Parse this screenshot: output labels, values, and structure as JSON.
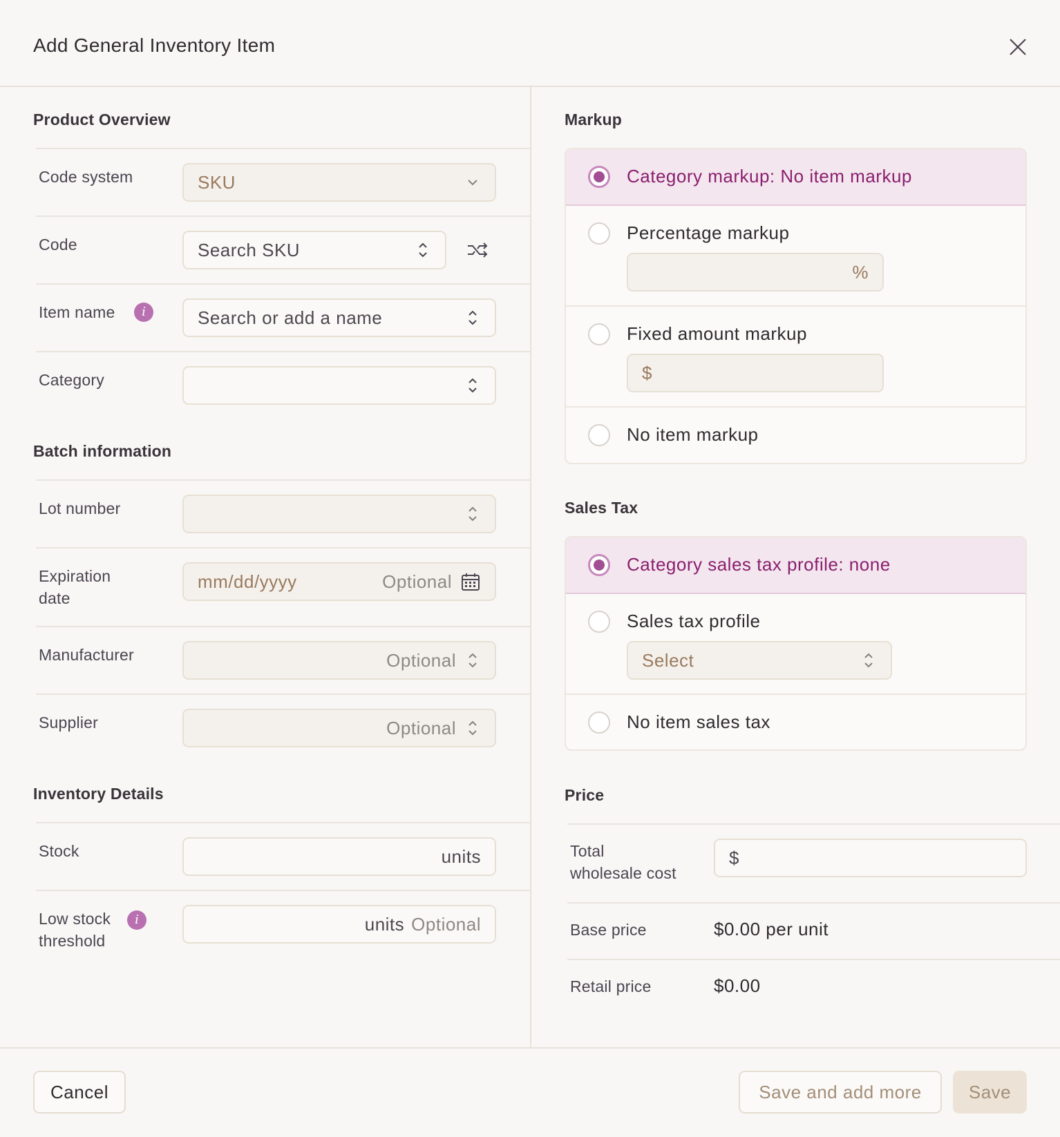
{
  "dialog": {
    "title": "Add General Inventory Item"
  },
  "product_overview": {
    "title": "Product Overview",
    "code_system": {
      "label": "Code system",
      "value": "SKU"
    },
    "code": {
      "label": "Code",
      "placeholder": "Search SKU"
    },
    "item_name": {
      "label": "Item name",
      "placeholder": "Search or add a name"
    },
    "category": {
      "label": "Category",
      "value": ""
    }
  },
  "batch_information": {
    "title": "Batch information",
    "lot_number": {
      "label": "Lot number",
      "value": ""
    },
    "expiration_date": {
      "label_line1": "Expiration",
      "label_line2": "date",
      "placeholder": "mm/dd/yyyy",
      "hint": "Optional"
    },
    "manufacturer": {
      "label": "Manufacturer",
      "hint": "Optional"
    },
    "supplier": {
      "label": "Supplier",
      "hint": "Optional"
    }
  },
  "inventory_details": {
    "title": "Inventory Details",
    "stock": {
      "label": "Stock",
      "unit": "units"
    },
    "low_stock": {
      "label_line1": "Low stock",
      "label_line2": "threshold",
      "unit": "units",
      "hint": "Optional"
    }
  },
  "markup": {
    "title": "Markup",
    "options": {
      "category": "Category markup: No item markup",
      "percentage": "Percentage markup",
      "percentage_symbol": "%",
      "fixed": "Fixed amount markup",
      "fixed_symbol": "$",
      "none": "No item markup"
    },
    "selected": "category"
  },
  "sales_tax": {
    "title": "Sales Tax",
    "options": {
      "category": "Category sales tax profile: none",
      "profile": "Sales tax profile",
      "profile_placeholder": "Select",
      "none": "No item sales tax"
    },
    "selected": "category"
  },
  "price": {
    "title": "Price",
    "total_wholesale": {
      "label_line1": "Total",
      "label_line2": "wholesale cost",
      "symbol": "$"
    },
    "base_price": {
      "label": "Base price",
      "value": "$0.00 per unit"
    },
    "retail_price": {
      "label": "Retail price",
      "value": "$0.00"
    }
  },
  "footer": {
    "cancel": "Cancel",
    "save_and_add_more": "Save and add more",
    "save": "Save"
  },
  "colors": {
    "accent": "#a24d94",
    "accent_text": "#8a1f6e",
    "selected_bg": "#f3e6ee",
    "field_border": "#e7dfd3",
    "background": "#f8f7f5"
  },
  "icons": [
    "close-icon",
    "chevron-down-icon",
    "chevron-updown-icon",
    "shuffle-icon",
    "info-icon",
    "calendar-icon"
  ]
}
